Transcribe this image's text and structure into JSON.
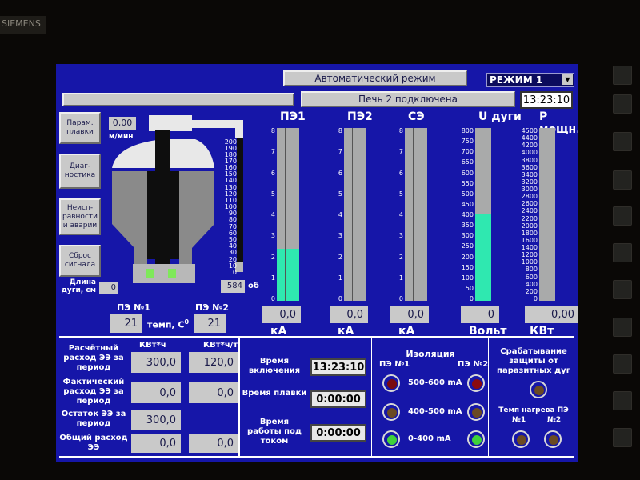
{
  "bezel": {
    "top_left_label": "SIEMENS"
  },
  "header": {
    "mode_banner": "Автоматический режим",
    "mode_select": "РЕЖИМ 1",
    "status": "Печь 2 подключена",
    "clock": "13:23:10"
  },
  "side_buttons": [
    "Парам. плавки",
    "Диаг- ностика",
    "Неисп- равности и аварии",
    "Сброс сигнала"
  ],
  "furnace": {
    "speed_value": "0,00",
    "speed_unit": "м/мин",
    "length_label": "Длина дуги, см",
    "length_value": "0",
    "position_value": "584",
    "position_unit": "об",
    "scale_ticks": [
      "200",
      "190",
      "180",
      "170",
      "160",
      "150",
      "140",
      "130",
      "120",
      "110",
      "100",
      "90",
      "80",
      "70",
      "60",
      "50",
      "40",
      "30",
      "20",
      "10",
      "0"
    ]
  },
  "gauges": [
    {
      "title": "ПЭ1",
      "value": "0,0",
      "unit": "кА",
      "fill_fraction": 0.3,
      "ticks": [
        "8",
        "7",
        "6",
        "5",
        "4",
        "3",
        "2",
        "1",
        "0"
      ]
    },
    {
      "title": "ПЭ2",
      "value": "0,0",
      "unit": "кА",
      "fill_fraction": 0,
      "ticks": [
        "8",
        "7",
        "6",
        "5",
        "4",
        "3",
        "2",
        "1",
        "0"
      ]
    },
    {
      "title": "СЭ",
      "value": "0,0",
      "unit": "кА",
      "fill_fraction": 0,
      "ticks": [
        "8",
        "7",
        "6",
        "5",
        "4",
        "3",
        "2",
        "1",
        "0"
      ]
    },
    {
      "title": "U дуги",
      "value": "0",
      "unit": "Вольт",
      "fill_fraction": 0.5,
      "ticks": [
        "800",
        "750",
        "700",
        "650",
        "600",
        "550",
        "500",
        "450",
        "400",
        "350",
        "300",
        "250",
        "200",
        "150",
        "100",
        "50",
        "0"
      ]
    },
    {
      "title": "P мощн.",
      "value": "0,00",
      "unit": "КВт",
      "fill_fraction": 0,
      "ticks": [
        "4500",
        "4400",
        "4200",
        "4000",
        "3800",
        "3600",
        "3400",
        "3200",
        "3000",
        "2800",
        "2600",
        "2400",
        "2200",
        "2000",
        "1800",
        "1600",
        "1400",
        "1200",
        "1000",
        "800",
        "600",
        "400",
        "200",
        "0"
      ]
    }
  ],
  "temps": {
    "pe1_label": "ПЭ №1",
    "pe2_label": "ПЭ №2",
    "pe1_value": "21",
    "pe2_value": "21",
    "caption": "темп, С",
    "caption_sup": "0"
  },
  "consumption": {
    "col1": "КВт*ч",
    "col2": "КВт*ч/т",
    "rows": [
      {
        "label": "Расчётный расход ЭЭ за период",
        "v1": "300,0",
        "v2": "120,0"
      },
      {
        "label": "Фактический расход ЭЭ за период",
        "v1": "0,0",
        "v2": "0,0"
      },
      {
        "label": "Остаток ЭЭ за период",
        "v1": "300,0",
        "v2": ""
      },
      {
        "label": "Общий расход ЭЭ",
        "v1": "0,0",
        "v2": "0,0"
      }
    ]
  },
  "times": [
    {
      "label": "Время включения",
      "value": "13:23:10"
    },
    {
      "label": "Время плавки",
      "value": "0:00:00"
    },
    {
      "label": "Время работы под током",
      "value": "0:00:00"
    }
  ],
  "isolation": {
    "title": "Изоляция",
    "pe1": "ПЭ №1",
    "pe2": "ПЭ №2",
    "rows": [
      {
        "label": "500-600 mA",
        "left_color": "#7a0a10",
        "right_color": "#8a0a10"
      },
      {
        "label": "400-500 mA",
        "left_color": "#6a4a22",
        "right_color": "#6a4a22"
      },
      {
        "label": "0-400 mA",
        "left_color": "#3fd23a",
        "right_color": "#3fd23a"
      }
    ]
  },
  "protection": {
    "title": "Срабатывание защиты от паразитных дуг",
    "lamp_color": "#6a4a22",
    "heat_title": "Темп нагрева ПЭ",
    "pe1": "№1",
    "pe2": "№2",
    "lamp1_color": "#6a4a22",
    "lamp2_color": "#6a4a22"
  }
}
